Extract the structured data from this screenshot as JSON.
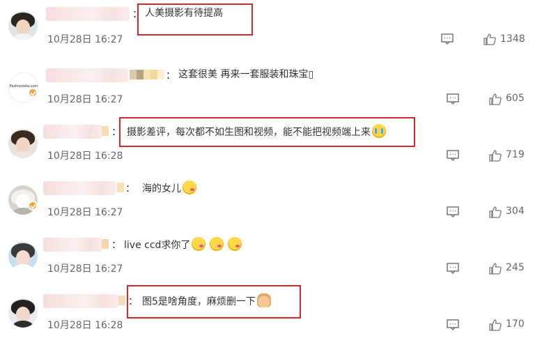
{
  "comments": [
    {
      "date": "10月28日 16:27",
      "text": "人美摄影有待提高",
      "likes": "1348",
      "reply_icon": "comment-icon",
      "like_icon": "thumbs-up-icon"
    },
    {
      "date": "10月28日 16:27",
      "text": "这套很美 再来一套服装和珠宝▯",
      "likes": "605",
      "reply_icon": "comment-icon",
      "like_icon": "thumbs-up-icon",
      "avatar_caption": "Fashionista.com"
    },
    {
      "date": "10月28日 16:28",
      "text": "摄影差评，每次都不如生图和视频，能不能把视频端上来",
      "likes": "719",
      "reply_icon": "comment-icon",
      "like_icon": "thumbs-up-icon",
      "emoji": "crying-face"
    },
    {
      "date": "10月28日 16:27",
      "text": "海的女儿",
      "likes": "304",
      "reply_icon": "comment-icon",
      "like_icon": "thumbs-up-icon",
      "emoji": "kiss-face"
    },
    {
      "date": "10月28日 16:27",
      "text": "live ccd求你了",
      "likes": "245",
      "reply_icon": "comment-icon",
      "like_icon": "thumbs-up-icon",
      "emoji": "kiss-face"
    },
    {
      "date": "10月28日 16:28",
      "text": "图5是啥角度，麻烦删一下",
      "likes": "170",
      "reply_icon": "comment-icon",
      "like_icon": "thumbs-up-icon",
      "emoji": "folded-hands"
    }
  ],
  "colon": "：",
  "highlight_color": "#d9252b"
}
